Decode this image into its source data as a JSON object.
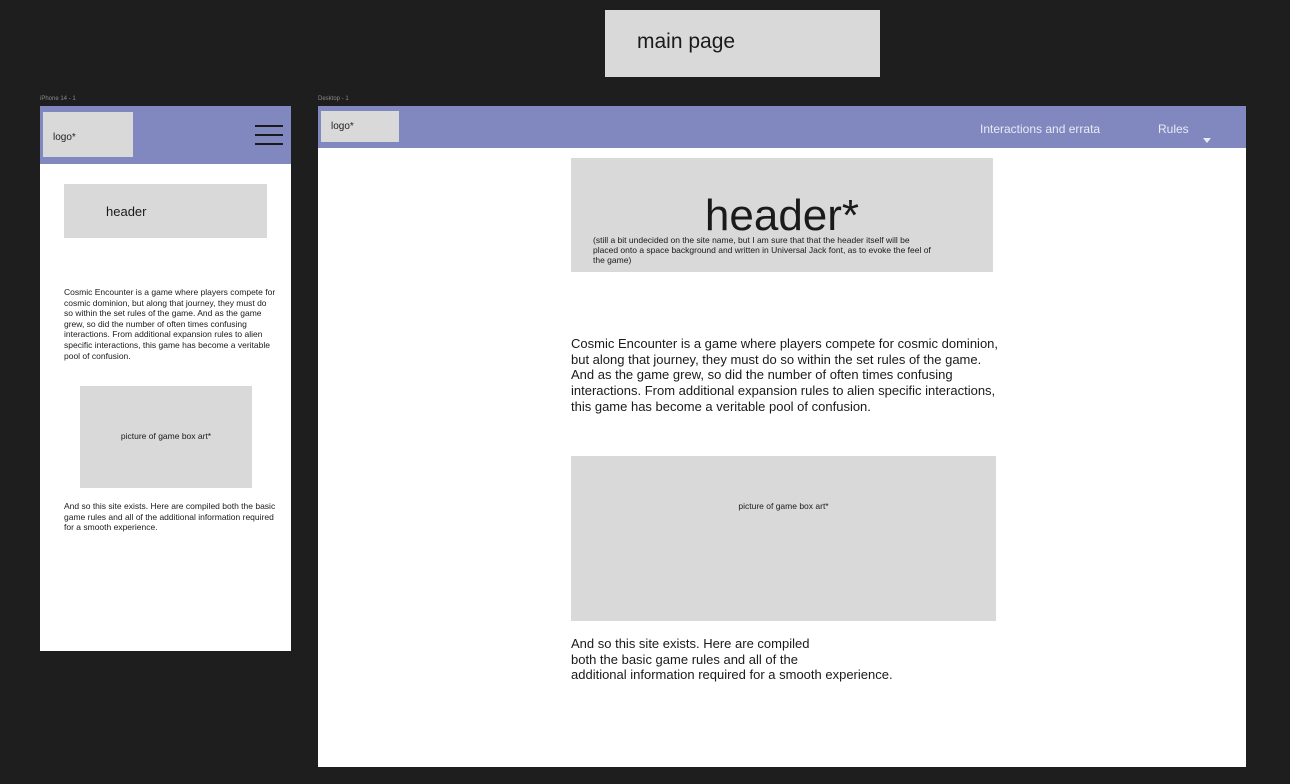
{
  "canvas": {
    "title": "main page",
    "phone_frame_label": "iPhone 14 - 1",
    "desktop_frame_label": "Desktop - 1"
  },
  "phone": {
    "logo": "logo*",
    "menu_icon": "hamburger-menu-icon",
    "header": "header",
    "intro": "Cosmic Encounter is a game where players compete for cosmic dominion, but along that journey, they must do so within the set rules of the game. And as the game grew, so did the number of often times confusing interactions. From additional expansion rules to alien specific interactions, this game has become a veritable pool of confusion.",
    "box_art": "picture of game box art*",
    "outro": "And so this site exists. Here are compiled both the basic game rules and all of the additional information required for a smooth experience."
  },
  "desktop": {
    "logo": "logo*",
    "nav": {
      "interactions": "Interactions and errata",
      "rules": "Rules",
      "rules_icon": "caret-down-icon"
    },
    "header_title": "header*",
    "header_note": "(still a bit undecided on the site name, but I am sure that that the header itself will be placed onto a space background and written in Universal Jack font, as to evoke the feel of the game)",
    "intro": "Cosmic Encounter is a game where players compete for cosmic dominion, but along that journey, they must do so within the set rules of the game. And as the game grew, so did the number of often times confusing interactions. From additional expansion rules to alien specific interactions, this game has become a veritable pool of confusion.",
    "box_art": "picture of game box art*",
    "outro_lines": [
      "And so this site exists. Here are compiled",
      "both the basic game rules and all of the",
      "additional information required for a smooth experience."
    ]
  },
  "colors": {
    "canvas_bg": "#1e1e1e",
    "nav_bg": "#8188bf",
    "placeholder_grey": "#d9d9d9",
    "frame_bg": "#ffffff"
  }
}
